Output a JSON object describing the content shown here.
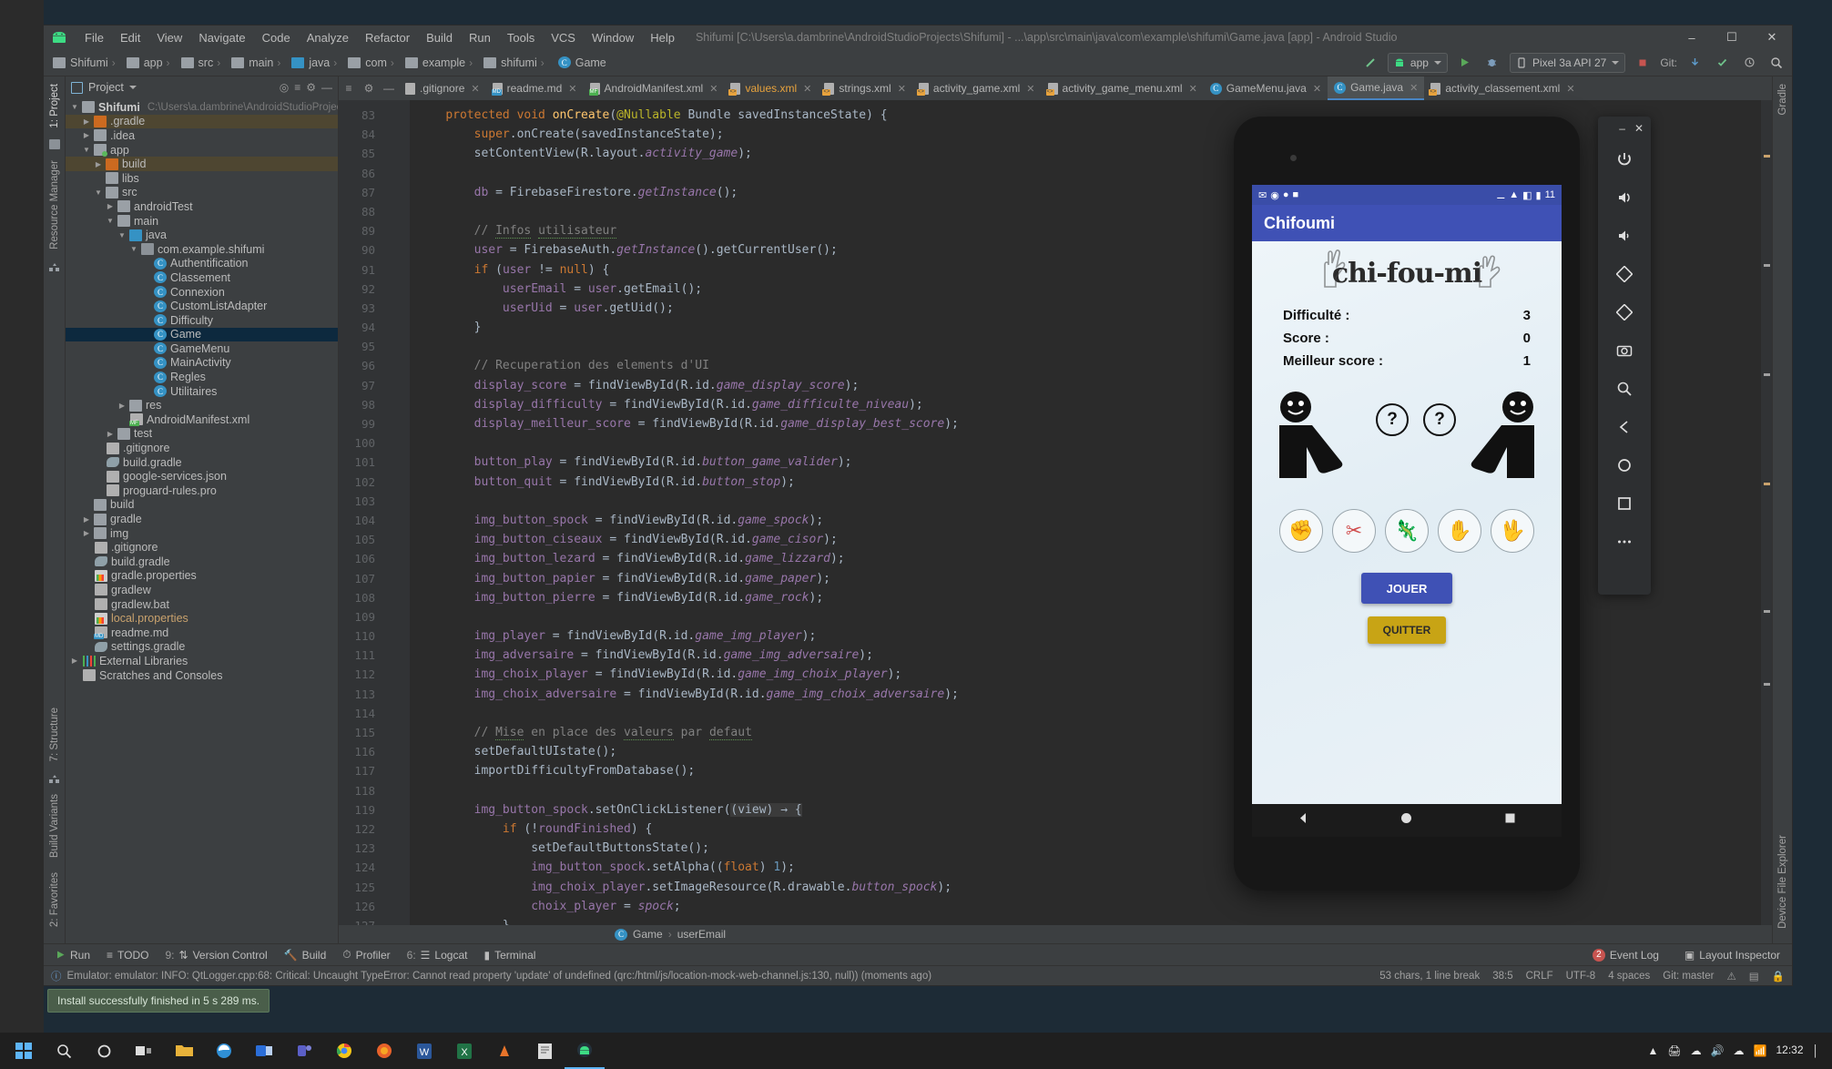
{
  "window": {
    "title": "Shifumi [C:\\Users\\a.dambrine\\AndroidStudioProjects\\Shifumi] - ...\\app\\src\\main\\java\\com\\example\\shifumi\\Game.java [app] - Android Studio",
    "minimize": "–",
    "maximize": "☐",
    "close": "✕"
  },
  "menu": [
    {
      "label": "File"
    },
    {
      "label": "Edit"
    },
    {
      "label": "View"
    },
    {
      "label": "Navigate"
    },
    {
      "label": "Code"
    },
    {
      "label": "Analyze"
    },
    {
      "label": "Refactor"
    },
    {
      "label": "Build"
    },
    {
      "label": "Run"
    },
    {
      "label": "Tools"
    },
    {
      "label": "VCS"
    },
    {
      "label": "Window"
    },
    {
      "label": "Help"
    }
  ],
  "breadcrumbs": [
    {
      "label": "Shifumi",
      "icon": "module-icon"
    },
    {
      "label": "app",
      "icon": "folder-icon"
    },
    {
      "label": "src",
      "icon": "folder-icon"
    },
    {
      "label": "main",
      "icon": "folder-icon"
    },
    {
      "label": "java",
      "icon": "folder-blue-icon"
    },
    {
      "label": "com",
      "icon": "package-icon"
    },
    {
      "label": "example",
      "icon": "package-icon"
    },
    {
      "label": "shifumi",
      "icon": "package-icon"
    },
    {
      "label": "Game",
      "icon": "class-icon"
    }
  ],
  "toolbar": {
    "run_config": "app",
    "device": "Pixel 3a API 27",
    "git_label": "Git:",
    "search_icon": "search-icon",
    "run_icon": "run-icon",
    "debug_icon": "debug-icon",
    "stop_icon": "stop-icon",
    "sync_icon": "sync-gradle-icon",
    "avd_icon": "avd-manager-icon",
    "sdk_icon": "sdk-manager-icon",
    "update_icon": "update-icon",
    "commit_icon": "commit-icon",
    "checkmark_icon": "checkmark-icon",
    "history_icon": "history-icon"
  },
  "project_panel": {
    "title": "Project",
    "tree": [
      {
        "depth": 0,
        "arrow": "down",
        "icon": "module-icon",
        "label": "Shifumi",
        "sub": "C:\\Users\\a.dambrine\\AndroidStudioProjects\\Shifu",
        "bold": true
      },
      {
        "depth": 1,
        "arrow": "right",
        "icon": "folder-orange-icon",
        "label": ".gradle",
        "hl": true
      },
      {
        "depth": 1,
        "arrow": "right",
        "icon": "folder-icon",
        "label": ".idea"
      },
      {
        "depth": 1,
        "arrow": "down",
        "icon": "folder-dot-icon",
        "label": "app"
      },
      {
        "depth": 2,
        "arrow": "right",
        "icon": "folder-orange-icon",
        "label": "build",
        "hl": true
      },
      {
        "depth": 2,
        "arrow": "none",
        "icon": "folder-icon",
        "label": "libs"
      },
      {
        "depth": 2,
        "arrow": "down",
        "icon": "folder-icon",
        "label": "src"
      },
      {
        "depth": 3,
        "arrow": "right",
        "icon": "folder-icon",
        "label": "androidTest"
      },
      {
        "depth": 3,
        "arrow": "down",
        "icon": "folder-icon",
        "label": "main"
      },
      {
        "depth": 4,
        "arrow": "down",
        "icon": "folder-blue-icon",
        "label": "java"
      },
      {
        "depth": 5,
        "arrow": "down",
        "icon": "package-icon",
        "label": "com.example.shifumi"
      },
      {
        "depth": 6,
        "arrow": "none",
        "icon": "class-icon",
        "label": "Authentification"
      },
      {
        "depth": 6,
        "arrow": "none",
        "icon": "class-icon",
        "label": "Classement"
      },
      {
        "depth": 6,
        "arrow": "none",
        "icon": "class-icon",
        "label": "Connexion"
      },
      {
        "depth": 6,
        "arrow": "none",
        "icon": "class-icon",
        "label": "CustomListAdapter"
      },
      {
        "depth": 6,
        "arrow": "none",
        "icon": "class-icon",
        "label": "Difficulty"
      },
      {
        "depth": 6,
        "arrow": "none",
        "icon": "class-icon",
        "label": "Game",
        "selected": true
      },
      {
        "depth": 6,
        "arrow": "none",
        "icon": "class-icon",
        "label": "GameMenu"
      },
      {
        "depth": 6,
        "arrow": "none",
        "icon": "class-icon",
        "label": "MainActivity"
      },
      {
        "depth": 6,
        "arrow": "none",
        "icon": "class-icon",
        "label": "Regles"
      },
      {
        "depth": 6,
        "arrow": "none",
        "icon": "class-icon",
        "label": "Utilitaires"
      },
      {
        "depth": 4,
        "arrow": "right",
        "icon": "folder-res-icon",
        "label": "res"
      },
      {
        "depth": 4,
        "arrow": "none",
        "icon": "manifest-icon",
        "label": "AndroidManifest.xml"
      },
      {
        "depth": 3,
        "arrow": "right",
        "icon": "folder-icon",
        "label": "test"
      },
      {
        "depth": 2,
        "arrow": "none",
        "icon": "gitignore-icon",
        "label": ".gitignore"
      },
      {
        "depth": 2,
        "arrow": "none",
        "icon": "gradle-icon",
        "label": "build.gradle"
      },
      {
        "depth": 2,
        "arrow": "none",
        "icon": "json-icon",
        "label": "google-services.json"
      },
      {
        "depth": 2,
        "arrow": "none",
        "icon": "text-file-icon",
        "label": "proguard-rules.pro"
      },
      {
        "depth": 1,
        "arrow": "none",
        "icon": "folder-icon",
        "label": "build"
      },
      {
        "depth": 1,
        "arrow": "right",
        "icon": "folder-icon",
        "label": "gradle"
      },
      {
        "depth": 1,
        "arrow": "right",
        "icon": "folder-icon",
        "label": "img"
      },
      {
        "depth": 1,
        "arrow": "none",
        "icon": "gitignore-icon",
        "label": ".gitignore"
      },
      {
        "depth": 1,
        "arrow": "none",
        "icon": "gradle-icon",
        "label": "build.gradle"
      },
      {
        "depth": 1,
        "arrow": "none",
        "icon": "properties-icon",
        "label": "gradle.properties"
      },
      {
        "depth": 1,
        "arrow": "none",
        "icon": "script-icon",
        "label": "gradlew"
      },
      {
        "depth": 1,
        "arrow": "none",
        "icon": "text-file-icon",
        "label": "gradlew.bat"
      },
      {
        "depth": 1,
        "arrow": "none",
        "icon": "properties-icon",
        "label": "local.properties",
        "orange": true
      },
      {
        "depth": 1,
        "arrow": "none",
        "icon": "markdown-icon",
        "label": "readme.md"
      },
      {
        "depth": 1,
        "arrow": "none",
        "icon": "gradle-icon",
        "label": "settings.gradle"
      },
      {
        "depth": 0,
        "arrow": "right",
        "icon": "libraries-icon",
        "label": "External Libraries"
      },
      {
        "depth": 0,
        "arrow": "none",
        "icon": "scratches-icon",
        "label": "Scratches and Consoles"
      }
    ]
  },
  "left_strips": [
    {
      "label": "1: Project",
      "selected": true
    },
    {
      "label": "Resource Manager",
      "selected": false
    }
  ],
  "left_strips_bottom": [
    {
      "label": "7: Structure"
    },
    {
      "label": "Build Variants"
    },
    {
      "label": "2: Favorites"
    }
  ],
  "right_strips": [
    {
      "label": "Gradle"
    },
    {
      "label": "Device File Explorer"
    }
  ],
  "editor_tabs": [
    {
      "label": ".gitignore",
      "icon": "gitignore-icon",
      "active": false
    },
    {
      "label": "readme.md",
      "icon": "markdown-icon",
      "active": false
    },
    {
      "label": "AndroidManifest.xml",
      "icon": "manifest-icon",
      "active": false
    },
    {
      "label": "values.xml",
      "icon": "xml-icon",
      "active": false,
      "color": "#e8a33d"
    },
    {
      "label": "strings.xml",
      "icon": "xml-icon",
      "active": false
    },
    {
      "label": "activity_game.xml",
      "icon": "xml-icon",
      "active": false
    },
    {
      "label": "activity_game_menu.xml",
      "icon": "xml-icon",
      "active": false
    },
    {
      "label": "GameMenu.java",
      "icon": "class-icon",
      "active": false
    },
    {
      "label": "Game.java",
      "icon": "class-icon",
      "active": true
    },
    {
      "label": "activity_classement.xml",
      "icon": "xml-icon",
      "active": false
    }
  ],
  "code": {
    "first_line": 83,
    "lines": [
      {
        "n": "83",
        "html": "    <span class='kw'>protected void </span><span class='fn'>onCreate</span>(<span class='an'>@Nullable </span>Bundle savedInstanceState) {"
      },
      {
        "n": "84",
        "html": "        <span class='kw'>super</span>.onCreate(savedInstanceState);"
      },
      {
        "n": "85",
        "html": "        setContentView(R.layout.<span class='fi'>activity_game</span>);"
      },
      {
        "n": "86",
        "html": ""
      },
      {
        "n": "87",
        "html": "        <span class='fd'>db </span>= FirebaseFirestore.<span class='fi'>getInstance</span>();"
      },
      {
        "n": "88",
        "html": ""
      },
      {
        "n": "89",
        "html": "        <span class='cm'>// <span class='sq'>Infos</span> <span class='sq'>utilisateur</span></span>"
      },
      {
        "n": "90",
        "html": "        <span class='fd'>user </span>= FirebaseAuth.<span class='fi'>getInstance</span>().getCurrentUser();"
      },
      {
        "n": "91",
        "html": "        <span class='kw'>if </span>(<span class='fd'>user </span>!= <span class='kw'>null</span>) {"
      },
      {
        "n": "92",
        "html": "            <span class='fd'>userEmail </span>= <span class='fd'>user</span>.getEmail();"
      },
      {
        "n": "93",
        "html": "            <span class='fd'>userUid </span>= <span class='fd'>user</span>.getUid();"
      },
      {
        "n": "94",
        "html": "        }"
      },
      {
        "n": "95",
        "html": ""
      },
      {
        "n": "96",
        "html": "        <span class='cm'>// Recuperation des elements d'UI</span>"
      },
      {
        "n": "97",
        "html": "        <span class='fd'>display_score </span>= findViewById(R.id.<span class='fi'>game_display_score</span>);"
      },
      {
        "n": "98",
        "html": "        <span class='fd'>display_difficulty </span>= findViewById(R.id.<span class='fi'>game_difficulte_niveau</span>);"
      },
      {
        "n": "99",
        "html": "        <span class='fd'>display_meilleur_score </span>= findViewById(R.id.<span class='fi'>game_display_best_score</span>);"
      },
      {
        "n": "100",
        "html": ""
      },
      {
        "n": "101",
        "html": "        <span class='fd'>button_play </span>= findViewById(R.id.<span class='fi'>button_game_valider</span>);"
      },
      {
        "n": "102",
        "html": "        <span class='fd'>button_quit </span>= findViewById(R.id.<span class='fi'>button_stop</span>);"
      },
      {
        "n": "103",
        "html": ""
      },
      {
        "n": "104",
        "html": "        <span class='fd'>img_button_spock </span>= findViewById(R.id.<span class='fi'>game_spock</span>);"
      },
      {
        "n": "105",
        "html": "        <span class='fd'>img_button_ciseaux </span>= findViewById(R.id.<span class='fi'>game_cisor</span>);"
      },
      {
        "n": "106",
        "html": "        <span class='fd'>img_button_lezard </span>= findViewById(R.id.<span class='fi'>game_lizzard</span>);"
      },
      {
        "n": "107",
        "html": "        <span class='fd'>img_button_papier </span>= findViewById(R.id.<span class='fi'>game_paper</span>);"
      },
      {
        "n": "108",
        "html": "        <span class='fd'>img_button_pierre </span>= findViewById(R.id.<span class='fi'>game_rock</span>);"
      },
      {
        "n": "109",
        "html": ""
      },
      {
        "n": "110",
        "html": "        <span class='fd'>img_player </span>= findViewById(R.id.<span class='fi'>game_img_player</span>);"
      },
      {
        "n": "111",
        "html": "        <span class='fd'>img_adversaire </span>= findViewById(R.id.<span class='fi'>game_img_adversaire</span>);"
      },
      {
        "n": "112",
        "html": "        <span class='fd'>img_choix_player </span>= findViewById(R.id.<span class='fi'>game_img_choix_player</span>);"
      },
      {
        "n": "113",
        "html": "        <span class='fd'>img_choix_adversaire </span>= findViewById(R.id.<span class='fi'>game_img_choix_adversaire</span>);"
      },
      {
        "n": "114",
        "html": ""
      },
      {
        "n": "115",
        "html": "        <span class='cm'>// <span class='sq'>Mise</span> en place des <span class='sq'>valeurs</span> par <span class='sq'>defaut</span></span>"
      },
      {
        "n": "116",
        "html": "        setDefaultUIstate();"
      },
      {
        "n": "117",
        "html": "        importDifficultyFromDatabase();"
      },
      {
        "n": "118",
        "html": ""
      },
      {
        "n": "119",
        "html": "        <span class='fd'>img_button_spock</span>.setOnClickListener(<span class='lam'>(view) → {</span>"
      },
      {
        "n": "122",
        "html": "            <span class='kw'>if </span>(!<span class='fd'>roundFinished</span>) {"
      },
      {
        "n": "123",
        "html": "                setDefaultButtonsState();"
      },
      {
        "n": "124",
        "html": "                <span class='fd'>img_button_spock</span>.setAlpha((<span class='kw'>float</span>) <span class='num'>1</span>);"
      },
      {
        "n": "125",
        "html": "                <span class='fd'>img_choix_player</span>.setImageResource(R.drawable.<span class='fi'>button_spock</span>);"
      },
      {
        "n": "126",
        "html": "                <span class='fd'>choix_player </span>= <span class='fi'>spock</span>;"
      },
      {
        "n": "127",
        "html": "            }"
      }
    ]
  },
  "editor_breadcrumb": [
    {
      "label": "Game",
      "icon": "class-icon"
    },
    {
      "label": "userEmail",
      "icon": "field-icon"
    }
  ],
  "bottom_tools": [
    {
      "label": "Run",
      "icon": "run-icon"
    },
    {
      "label": "TODO",
      "icon": "todo-icon"
    },
    {
      "label": "Version Control",
      "num": "9:",
      "icon": "vcs-icon"
    },
    {
      "label": "Build",
      "icon": "build-icon"
    },
    {
      "label": "Profiler",
      "icon": "profiler-icon"
    },
    {
      "label": "Logcat",
      "num": "6:",
      "icon": "logcat-icon"
    },
    {
      "label": "Terminal",
      "icon": "terminal-icon"
    }
  ],
  "bottom_right": [
    {
      "label": "Event Log",
      "badge": "2"
    },
    {
      "label": "Layout Inspector"
    }
  ],
  "status": {
    "message": "Emulator: emulator: INFO: QtLogger.cpp:68: Critical: Uncaught TypeError: Cannot read property 'update' of undefined (qrc:/html/js/location-mock-web-channel.js:130, null)) (moments ago)",
    "chars": "53 chars, 1 line break",
    "caret": "38:5",
    "lineending": "CRLF",
    "encoding": "UTF-8",
    "indent": "4 spaces",
    "git_branch": "Git: master"
  },
  "balloon": {
    "text": "Install successfully finished in 5 s 289 ms."
  },
  "emulator": {
    "statusbar": {
      "time": "11",
      "icons": [
        "gmail-icon",
        "chrome-icon",
        "android-icon",
        "message-icon"
      ],
      "right_icons": [
        "dnd-icon",
        "wifi-icon",
        "signal-icon",
        "battery-icon"
      ]
    },
    "app_title": "Chifoumi",
    "logo": "chi-fou-mi",
    "stats": [
      {
        "label": "Difficulté :",
        "value": "3"
      },
      {
        "label": "Score :",
        "value": "0"
      },
      {
        "label": "Meilleur score :",
        "value": "1"
      }
    ],
    "player_placeholder": "?",
    "opponent_placeholder": "?",
    "choices": [
      {
        "name": "rock-choice",
        "glyph": "✊"
      },
      {
        "name": "scissors-choice",
        "glyph": "✂"
      },
      {
        "name": "lizard-choice",
        "glyph": "🦎"
      },
      {
        "name": "paper-choice",
        "glyph": "✋"
      },
      {
        "name": "spock-choice",
        "glyph": "🖖"
      }
    ],
    "play_button": "JOUER",
    "quit_button": "QUITTER",
    "nav": [
      "back-button",
      "home-button",
      "recents-button"
    ]
  },
  "emulator_tools": [
    {
      "name": "power-icon"
    },
    {
      "name": "volume-up-icon"
    },
    {
      "name": "volume-down-icon"
    },
    {
      "name": "rotate-left-icon"
    },
    {
      "name": "rotate-right-icon"
    },
    {
      "name": "camera-icon"
    },
    {
      "name": "zoom-icon"
    },
    {
      "name": "back-icon"
    },
    {
      "name": "home-icon"
    },
    {
      "name": "overview-icon"
    },
    {
      "name": "more-icon"
    }
  ],
  "taskbar": {
    "items": [
      "start-icon",
      "search-icon",
      "cortana-icon",
      "taskview-icon",
      "explorer-icon",
      "edge-icon",
      "outlook-icon",
      "teams-icon",
      "chrome-icon",
      "firefox-icon",
      "word-icon",
      "excel-icon",
      "vlc-icon",
      "notepad-icon",
      "android-studio-icon"
    ],
    "time": "12:32",
    "date": ""
  }
}
